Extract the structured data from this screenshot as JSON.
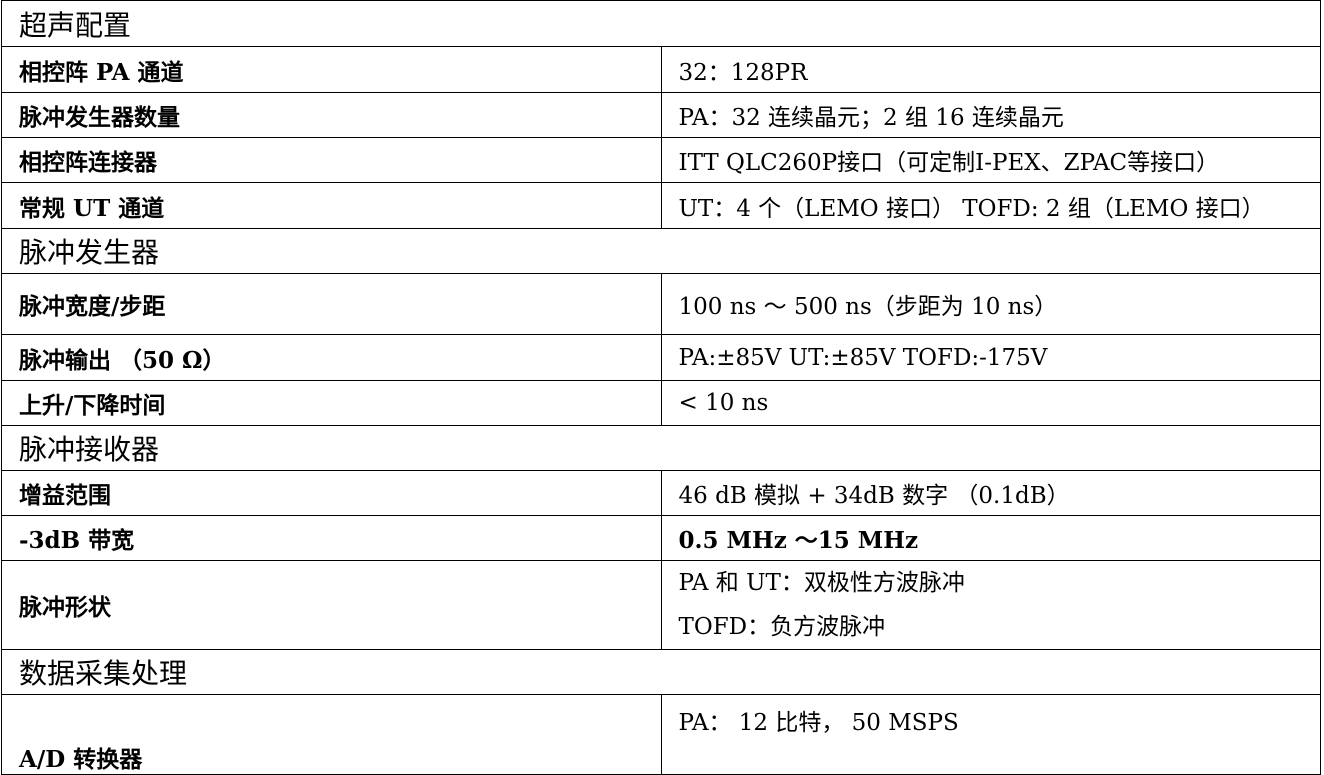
{
  "sections": [
    {
      "title": "超声配置",
      "rows": [
        {
          "label": "相控阵 PA 通道",
          "value": [
            "32：128PR"
          ]
        },
        {
          "label": "脉冲发生器数量",
          "value": [
            "PA：32 连续晶元；2 组 16 连续晶元"
          ]
        },
        {
          "label": "相控阵连接器",
          "value": [
            "ITT QLC260P接口（可定制I-PEX、ZPAC等接口）"
          ]
        },
        {
          "label": "常规 UT 通道",
          "value": [
            "UT：4 个（LEMO 接口）  TOFD: 2 组（LEMO 接口）"
          ]
        }
      ]
    },
    {
      "title": "脉冲发生器",
      "rows": [
        {
          "label": "脉冲宽度/步距",
          "value": [
            "100 ns ～ 500 ns（步距为 10 ns）"
          ]
        },
        {
          "label": "脉冲输出 （50 Ω）",
          "value": [
            "PA:±85V  UT:±85V  TOFD:-175V"
          ]
        },
        {
          "label": "上升/下降时间",
          "value": [
            "< 10 ns"
          ]
        }
      ]
    },
    {
      "title": "脉冲接收器",
      "rows": [
        {
          "label": "增益范围",
          "value": [
            "46 dB 模拟 + 34dB 数字 （0.1dB）"
          ]
        },
        {
          "label": "-3dB 带宽",
          "value": [
            "0.5 MHz ～15 MHz"
          ]
        },
        {
          "label": "脉冲形状",
          "value": [
            "PA 和 UT：双极性方波脉冲",
            "TOFD：负方波脉冲"
          ]
        }
      ]
    },
    {
      "title": "数据采集处理",
      "rows": [
        {
          "label": "A/D 转换器",
          "value": [
            "PA： 12 比特， 50 MSPS"
          ]
        }
      ]
    }
  ]
}
